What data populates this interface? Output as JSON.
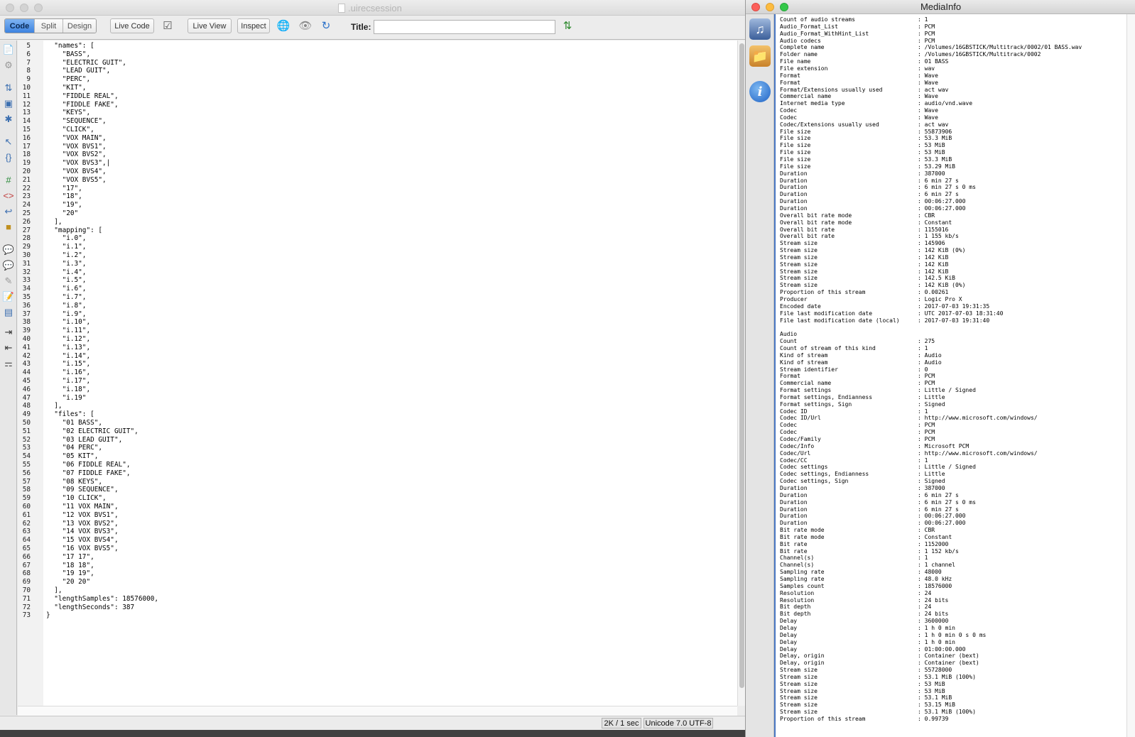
{
  "editor_window": {
    "title": ".uirecsession",
    "toolbar": {
      "code_label": "Code",
      "split_label": "Split",
      "design_label": "Design",
      "live_code_label": "Live Code",
      "live_view_label": "Live View",
      "inspect_label": "Inspect",
      "title_label": "Title:",
      "title_value": ""
    },
    "code_lines": [
      {
        "n": "5",
        "t": "  \"names\": ["
      },
      {
        "n": "6",
        "t": "    \"BASS\","
      },
      {
        "n": "7",
        "t": "    \"ELECTRIC GUIT\","
      },
      {
        "n": "8",
        "t": "    \"LEAD GUIT\","
      },
      {
        "n": "9",
        "t": "    \"PERC\","
      },
      {
        "n": "10",
        "t": "    \"KIT\","
      },
      {
        "n": "11",
        "t": "    \"FIDDLE REAL\","
      },
      {
        "n": "12",
        "t": "    \"FIDDLE FAKE\","
      },
      {
        "n": "13",
        "t": "    \"KEYS\","
      },
      {
        "n": "14",
        "t": "    \"SEQUENCE\","
      },
      {
        "n": "15",
        "t": "    \"CLICK\","
      },
      {
        "n": "16",
        "t": "    \"VOX MAIN\","
      },
      {
        "n": "17",
        "t": "    \"VOX BVS1\","
      },
      {
        "n": "18",
        "t": "    \"VOX BVS2\","
      },
      {
        "n": "19",
        "t": "    \"VOX BVS3\",|"
      },
      {
        "n": "20",
        "t": "    \"VOX BVS4\","
      },
      {
        "n": "21",
        "t": "    \"VOX BVS5\","
      },
      {
        "n": "22",
        "t": "    \"17\","
      },
      {
        "n": "23",
        "t": "    \"18\","
      },
      {
        "n": "24",
        "t": "    \"19\","
      },
      {
        "n": "25",
        "t": "    \"20\""
      },
      {
        "n": "26",
        "t": "  ],"
      },
      {
        "n": "27",
        "t": "  \"mapping\": ["
      },
      {
        "n": "28",
        "t": "    \"i.0\","
      },
      {
        "n": "29",
        "t": "    \"i.1\","
      },
      {
        "n": "30",
        "t": "    \"i.2\","
      },
      {
        "n": "31",
        "t": "    \"i.3\","
      },
      {
        "n": "32",
        "t": "    \"i.4\","
      },
      {
        "n": "33",
        "t": "    \"i.5\","
      },
      {
        "n": "34",
        "t": "    \"i.6\","
      },
      {
        "n": "35",
        "t": "    \"i.7\","
      },
      {
        "n": "36",
        "t": "    \"i.8\","
      },
      {
        "n": "37",
        "t": "    \"i.9\","
      },
      {
        "n": "38",
        "t": "    \"i.10\","
      },
      {
        "n": "39",
        "t": "    \"i.11\","
      },
      {
        "n": "40",
        "t": "    \"i.12\","
      },
      {
        "n": "41",
        "t": "    \"i.13\","
      },
      {
        "n": "42",
        "t": "    \"i.14\","
      },
      {
        "n": "43",
        "t": "    \"i.15\","
      },
      {
        "n": "44",
        "t": "    \"i.16\","
      },
      {
        "n": "45",
        "t": "    \"i.17\","
      },
      {
        "n": "46",
        "t": "    \"i.18\","
      },
      {
        "n": "47",
        "t": "    \"i.19\""
      },
      {
        "n": "48",
        "t": "  ],"
      },
      {
        "n": "49",
        "t": "  \"files\": ["
      },
      {
        "n": "50",
        "t": "    \"01 BASS\","
      },
      {
        "n": "51",
        "t": "    \"02 ELECTRIC GUIT\","
      },
      {
        "n": "52",
        "t": "    \"03 LEAD GUIT\","
      },
      {
        "n": "53",
        "t": "    \"04 PERC\","
      },
      {
        "n": "54",
        "t": "    \"05 KIT\","
      },
      {
        "n": "55",
        "t": "    \"06 FIDDLE REAL\","
      },
      {
        "n": "56",
        "t": "    \"07 FIDDLE FAKE\","
      },
      {
        "n": "57",
        "t": "    \"08 KEYS\","
      },
      {
        "n": "58",
        "t": "    \"09 SEQUENCE\","
      },
      {
        "n": "59",
        "t": "    \"10 CLICK\","
      },
      {
        "n": "60",
        "t": "    \"11 VOX MAIN\","
      },
      {
        "n": "61",
        "t": "    \"12 VOX BVS1\","
      },
      {
        "n": "62",
        "t": "    \"13 VOX BVS2\","
      },
      {
        "n": "63",
        "t": "    \"14 VOX BVS3\","
      },
      {
        "n": "64",
        "t": "    \"15 VOX BVS4\","
      },
      {
        "n": "65",
        "t": "    \"16 VOX BVS5\","
      },
      {
        "n": "66",
        "t": "    \"17 17\","
      },
      {
        "n": "67",
        "t": "    \"18 18\","
      },
      {
        "n": "68",
        "t": "    \"19 19\","
      },
      {
        "n": "69",
        "t": "    \"20 20\""
      },
      {
        "n": "70",
        "t": "  ],"
      },
      {
        "n": "71",
        "t": "  \"lengthSamples\": 18576000,"
      },
      {
        "n": "72",
        "t": "  \"lengthSeconds\": 387"
      },
      {
        "n": "73",
        "t": "}"
      }
    ],
    "status": {
      "size_time": "2K / 1 sec",
      "encoding": "Unicode 7.0 UTF-8"
    }
  },
  "mediainfo_window": {
    "title": "MediaInfo",
    "rows": [
      {
        "k": "Count of audio streams",
        "v": ": 1"
      },
      {
        "k": "Audio_Format_List",
        "v": ": PCM"
      },
      {
        "k": "Audio_Format_WithHint_List",
        "v": ": PCM"
      },
      {
        "k": "Audio codecs",
        "v": ": PCM"
      },
      {
        "k": "Complete name",
        "v": ": /Volumes/16GBSTICK/Multitrack/0002/01 BASS.wav"
      },
      {
        "k": "Folder name",
        "v": ": /Volumes/16GBSTICK/Multitrack/0002"
      },
      {
        "k": "File name",
        "v": ": 01 BASS"
      },
      {
        "k": "File extension",
        "v": ": wav"
      },
      {
        "k": "Format",
        "v": ": Wave"
      },
      {
        "k": "Format",
        "v": ": Wave"
      },
      {
        "k": "Format/Extensions usually used",
        "v": ": act wav"
      },
      {
        "k": "Commercial name",
        "v": ": Wave"
      },
      {
        "k": "Internet media type",
        "v": ": audio/vnd.wave"
      },
      {
        "k": "Codec",
        "v": ": Wave"
      },
      {
        "k": "Codec",
        "v": ": Wave"
      },
      {
        "k": "Codec/Extensions usually used",
        "v": ": act wav"
      },
      {
        "k": "File size",
        "v": ": 55873906"
      },
      {
        "k": "File size",
        "v": ": 53.3 MiB"
      },
      {
        "k": "File size",
        "v": ": 53 MiB"
      },
      {
        "k": "File size",
        "v": ": 53 MiB"
      },
      {
        "k": "File size",
        "v": ": 53.3 MiB"
      },
      {
        "k": "File size",
        "v": ": 53.29 MiB"
      },
      {
        "k": "Duration",
        "v": ": 387000"
      },
      {
        "k": "Duration",
        "v": ": 6 min 27 s"
      },
      {
        "k": "Duration",
        "v": ": 6 min 27 s 0 ms"
      },
      {
        "k": "Duration",
        "v": ": 6 min 27 s"
      },
      {
        "k": "Duration",
        "v": ": 00:06:27.000"
      },
      {
        "k": "Duration",
        "v": ": 00:06:27.000"
      },
      {
        "k": "Overall bit rate mode",
        "v": ": CBR"
      },
      {
        "k": "Overall bit rate mode",
        "v": ": Constant"
      },
      {
        "k": "Overall bit rate",
        "v": ": 1155016"
      },
      {
        "k": "Overall bit rate",
        "v": ": 1 155 kb/s"
      },
      {
        "k": "Stream size",
        "v": ": 145906"
      },
      {
        "k": "Stream size",
        "v": ": 142 KiB (0%)"
      },
      {
        "k": "Stream size",
        "v": ": 142 KiB"
      },
      {
        "k": "Stream size",
        "v": ": 142 KiB"
      },
      {
        "k": "Stream size",
        "v": ": 142 KiB"
      },
      {
        "k": "Stream size",
        "v": ": 142.5 KiB"
      },
      {
        "k": "Stream size",
        "v": ": 142 KiB (0%)"
      },
      {
        "k": "Proportion of this stream",
        "v": ": 0.00261"
      },
      {
        "k": "Producer",
        "v": ": Logic Pro X"
      },
      {
        "k": "Encoded date",
        "v": ": 2017-07-03 19:31:35"
      },
      {
        "k": "File last modification date",
        "v": ": UTC 2017-07-03 18:31:40"
      },
      {
        "k": "File last modification date (local)",
        "v": ": 2017-07-03 19:31:40"
      },
      {
        "k": "",
        "v": ""
      },
      {
        "k": "Audio",
        "v": ""
      },
      {
        "k": "Count",
        "v": ": 275"
      },
      {
        "k": "Count of stream of this kind",
        "v": ": 1"
      },
      {
        "k": "Kind of stream",
        "v": ": Audio"
      },
      {
        "k": "Kind of stream",
        "v": ": Audio"
      },
      {
        "k": "Stream identifier",
        "v": ": 0"
      },
      {
        "k": "Format",
        "v": ": PCM"
      },
      {
        "k": "Commercial name",
        "v": ": PCM"
      },
      {
        "k": "Format settings",
        "v": ": Little / Signed"
      },
      {
        "k": "Format settings, Endianness",
        "v": ": Little"
      },
      {
        "k": "Format settings, Sign",
        "v": ": Signed"
      },
      {
        "k": "Codec ID",
        "v": ": 1"
      },
      {
        "k": "Codec ID/Url",
        "v": ": http://www.microsoft.com/windows/"
      },
      {
        "k": "Codec",
        "v": ": PCM"
      },
      {
        "k": "Codec",
        "v": ": PCM"
      },
      {
        "k": "Codec/Family",
        "v": ": PCM"
      },
      {
        "k": "Codec/Info",
        "v": ": Microsoft PCM"
      },
      {
        "k": "Codec/Url",
        "v": ": http://www.microsoft.com/windows/"
      },
      {
        "k": "Codec/CC",
        "v": ": 1"
      },
      {
        "k": "Codec settings",
        "v": ": Little / Signed"
      },
      {
        "k": "Codec settings, Endianness",
        "v": ": Little"
      },
      {
        "k": "Codec settings, Sign",
        "v": ": Signed"
      },
      {
        "k": "Duration",
        "v": ": 387000"
      },
      {
        "k": "Duration",
        "v": ": 6 min 27 s"
      },
      {
        "k": "Duration",
        "v": ": 6 min 27 s 0 ms"
      },
      {
        "k": "Duration",
        "v": ": 6 min 27 s"
      },
      {
        "k": "Duration",
        "v": ": 00:06:27.000"
      },
      {
        "k": "Duration",
        "v": ": 00:06:27.000"
      },
      {
        "k": "Bit rate mode",
        "v": ": CBR"
      },
      {
        "k": "Bit rate mode",
        "v": ": Constant"
      },
      {
        "k": "Bit rate",
        "v": ": 1152000"
      },
      {
        "k": "Bit rate",
        "v": ": 1 152 kb/s"
      },
      {
        "k": "Channel(s)",
        "v": ": 1"
      },
      {
        "k": "Channel(s)",
        "v": ": 1 channel"
      },
      {
        "k": "Sampling rate",
        "v": ": 48000"
      },
      {
        "k": "Sampling rate",
        "v": ": 48.0 kHz"
      },
      {
        "k": "Samples count",
        "v": ": 18576000"
      },
      {
        "k": "Resolution",
        "v": ": 24"
      },
      {
        "k": "Resolution",
        "v": ": 24 bits"
      },
      {
        "k": "Bit depth",
        "v": ": 24"
      },
      {
        "k": "Bit depth",
        "v": ": 24 bits"
      },
      {
        "k": "Delay",
        "v": ": 3600000"
      },
      {
        "k": "Delay",
        "v": ": 1 h 0 min"
      },
      {
        "k": "Delay",
        "v": ": 1 h 0 min 0 s 0 ms"
      },
      {
        "k": "Delay",
        "v": ": 1 h 0 min"
      },
      {
        "k": "Delay",
        "v": ": 01:00:00.000"
      },
      {
        "k": "Delay, origin",
        "v": ": Container (bext)"
      },
      {
        "k": "Delay, origin",
        "v": ": Container (bext)"
      },
      {
        "k": "Stream size",
        "v": ": 55728000"
      },
      {
        "k": "Stream size",
        "v": ": 53.1 MiB (100%)"
      },
      {
        "k": "Stream size",
        "v": ": 53 MiB"
      },
      {
        "k": "Stream size",
        "v": ": 53 MiB"
      },
      {
        "k": "Stream size",
        "v": ": 53.1 MiB"
      },
      {
        "k": "Stream size",
        "v": ": 53.15 MiB"
      },
      {
        "k": "Stream size",
        "v": ": 53.1 MiB (100%)"
      },
      {
        "k": "Proportion of this stream",
        "v": ": 0.99739"
      }
    ]
  },
  "colors": {
    "accent": "#3d83e0",
    "mediainfo_border": "#4a78c4",
    "close": "#fc605b",
    "minimize": "#fdbc40",
    "zoom": "#34c84a"
  },
  "icons": {
    "sidebar": [
      "media-file-icon",
      "media-folder-icon",
      "info-icon"
    ]
  }
}
